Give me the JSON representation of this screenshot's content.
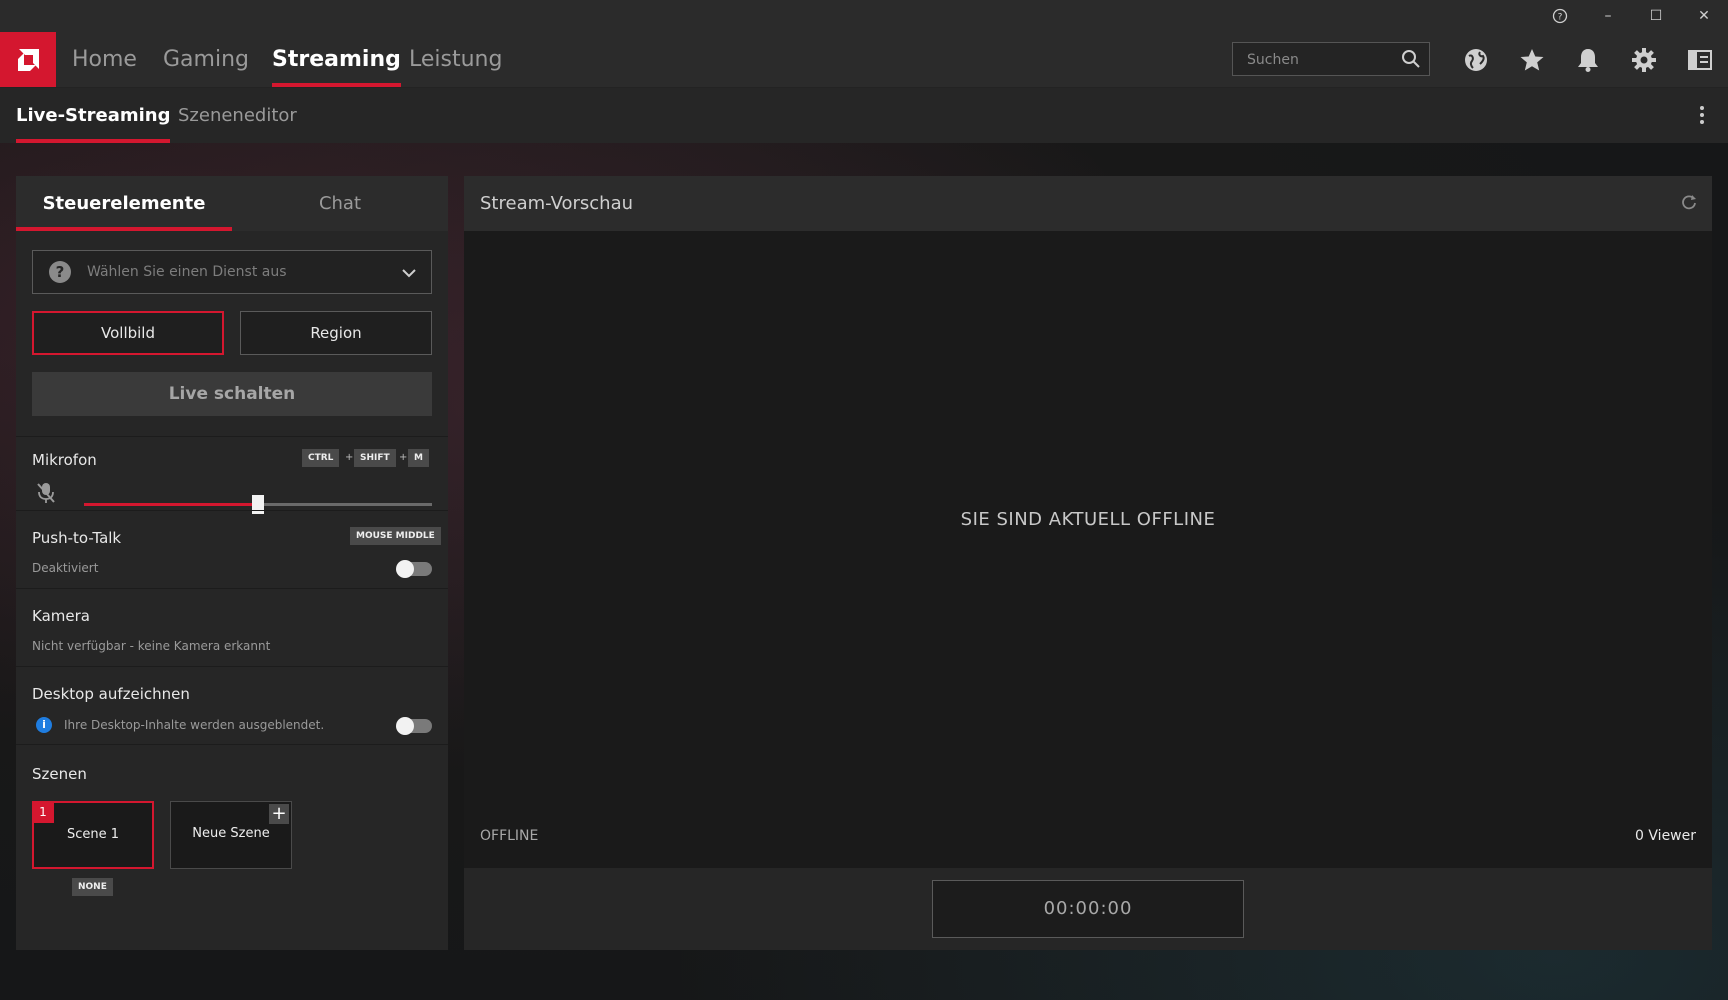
{
  "window": {
    "help_label": "?",
    "minimize_label": "–",
    "maximize_label": "☐",
    "close_label": "✕"
  },
  "nav": {
    "items": [
      {
        "label": "Home"
      },
      {
        "label": "Gaming"
      },
      {
        "label": "Streaming"
      },
      {
        "label": "Leistung"
      }
    ],
    "active": "Streaming",
    "search_placeholder": "Suchen"
  },
  "subnav": {
    "items": [
      {
        "label": "Live-Streaming"
      },
      {
        "label": "Szeneneditor"
      }
    ],
    "active": "Live-Streaming"
  },
  "left_panel": {
    "tabs": [
      {
        "label": "Steuerelemente"
      },
      {
        "label": "Chat"
      }
    ],
    "active_tab": "Steuerelemente",
    "service_dropdown": {
      "placeholder": "Wählen Sie einen Dienst aus",
      "icon": "question-icon"
    },
    "capture_buttons": {
      "fullscreen": "Vollbild",
      "region": "Region",
      "selected": "Vollbild"
    },
    "go_live": "Live schalten",
    "microphone": {
      "label": "Mikrofon",
      "hotkeys": [
        "CTRL",
        "SHIFT",
        "M"
      ],
      "hotkey_separator": "+",
      "muted_icon": "mic-muted-icon",
      "level": 0.5
    },
    "push_to_talk": {
      "label": "Push-to-Talk",
      "hotkey": "MOUSE MIDDLE",
      "status": "Deaktiviert",
      "enabled": false
    },
    "camera": {
      "label": "Kamera",
      "status": "Nicht verfügbar - keine Kamera erkannt"
    },
    "desktop_capture": {
      "label": "Desktop aufzeichnen",
      "info": "Ihre Desktop-Inhalte werden ausgeblendet.",
      "info_icon": "info-icon",
      "enabled": false
    },
    "scenes": {
      "label": "Szenen",
      "items": [
        {
          "number": "1",
          "name": "Scene 1",
          "hotkey": "NONE"
        }
      ],
      "new_scene": "Neue Szene"
    }
  },
  "preview": {
    "title": "Stream-Vorschau",
    "message": "SIE SIND AKTUELL OFFLINE",
    "status": "OFFLINE",
    "viewers": "0 Viewer",
    "timer": "00:00:00"
  },
  "colors": {
    "accent": "#d4172f",
    "panel": "#262626",
    "preview_bg": "#1a1a1a",
    "info": "#1f7de0"
  }
}
